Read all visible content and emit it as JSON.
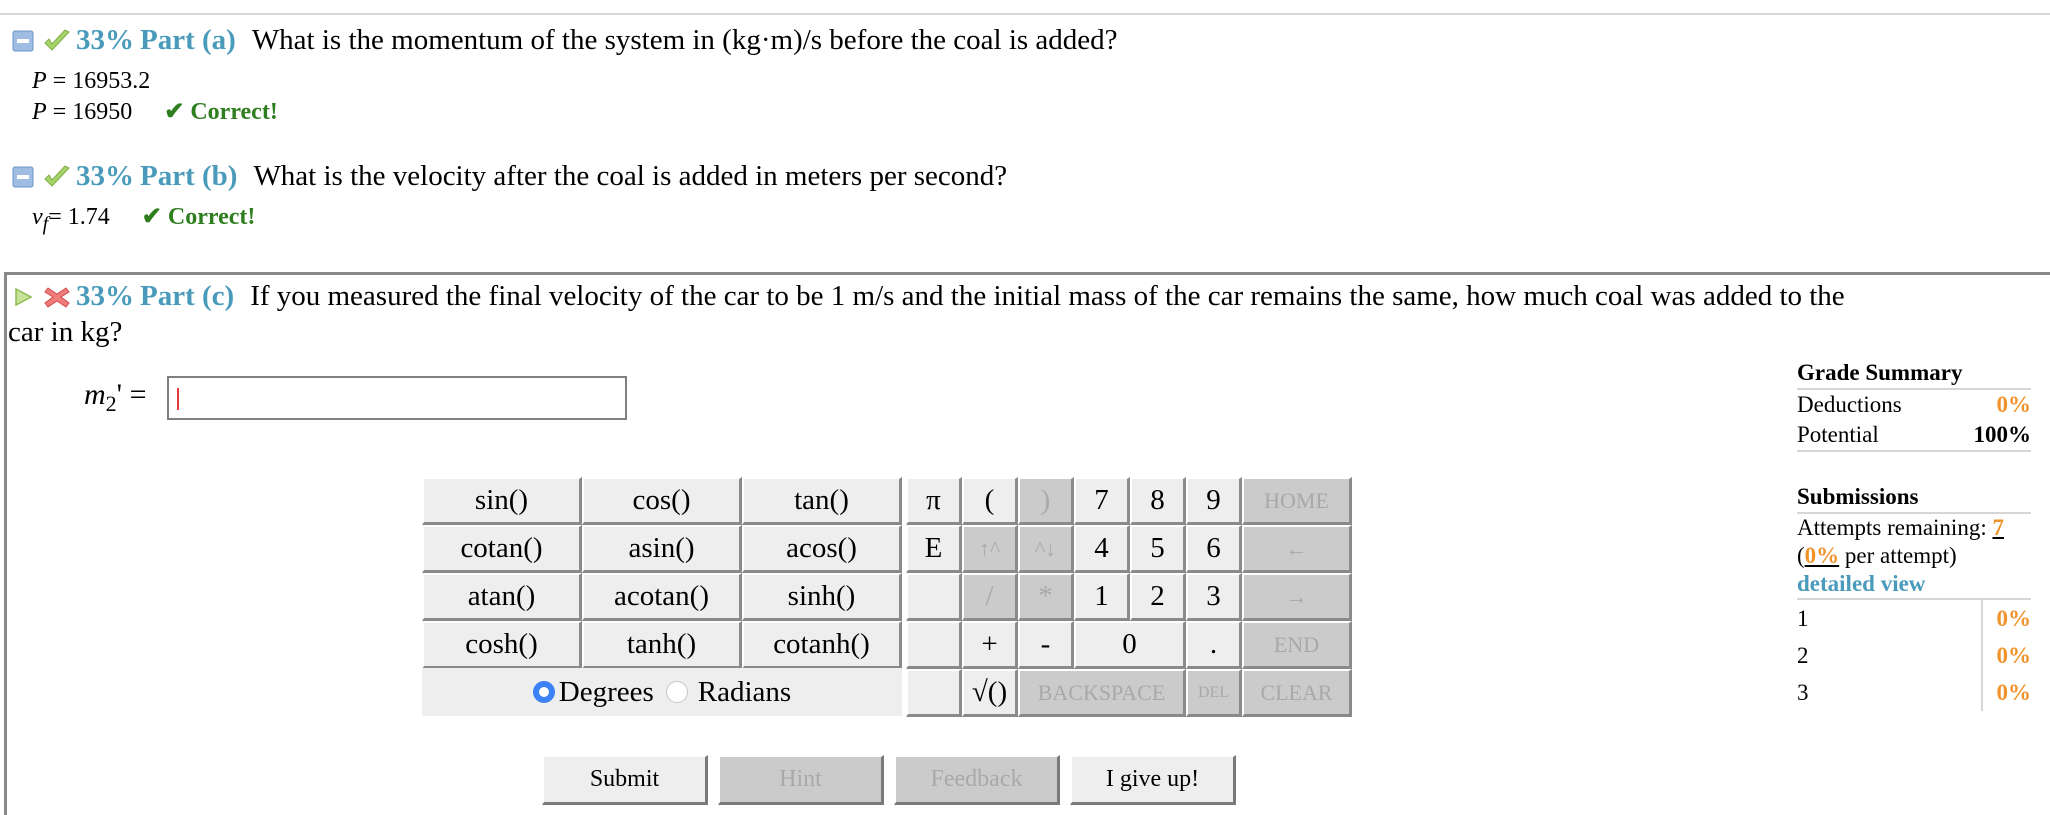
{
  "parts": [
    {
      "id": "a",
      "percent": "33%",
      "label": "Part (a)",
      "status": "correct",
      "question": "What is the momentum of the system in (kg·m)/s before the coal is added?",
      "answers": [
        {
          "var": "P",
          "text": " = 16953.2",
          "feedback": ""
        },
        {
          "var": "P",
          "text": " = 16950",
          "feedback": "✔ Correct!"
        }
      ]
    },
    {
      "id": "b",
      "percent": "33%",
      "label": "Part (b)",
      "status": "correct",
      "question": "What is the velocity after the coal is added in meters per second?",
      "answers": [
        {
          "var": "v",
          "sub": "f",
          "text": "= 1.74",
          "feedback": "✔ Correct!"
        }
      ]
    },
    {
      "id": "c",
      "percent": "33%",
      "label": "Part (c)",
      "status": "incorrect",
      "question_line1": "If you measured the final velocity of the car to be 1 m/s and the initial mass of the car remains the same, how much coal was added to the",
      "question_line2": "car in kg?",
      "input": {
        "var": "m",
        "sub": "2",
        "prime": "'",
        "eq": " =",
        "value": "",
        "placeholder": ""
      }
    }
  ],
  "icons": {
    "toggle_collapse": "collapse-icon",
    "toggle_expand": "expand-triangle-icon",
    "correct": "green-check-icon",
    "incorrect": "red-x-icon"
  },
  "keypad": {
    "functions": [
      [
        "sin()",
        "cos()",
        "tan()"
      ],
      [
        "cotan()",
        "asin()",
        "acos()"
      ],
      [
        "atan()",
        "acotan()",
        "sinh()"
      ],
      [
        "cosh()",
        "tanh()",
        "cotanh()"
      ]
    ],
    "angle_mode": {
      "options": [
        "Degrees",
        "Radians"
      ],
      "selected": "Degrees"
    },
    "keys": {
      "pi": "π",
      "e": "E",
      "lparen": "(",
      "rparen": ")",
      "up": "↑^",
      "down": "^↓",
      "divide": "/",
      "multiply": "*",
      "plus": "+",
      "minus": "-",
      "sqrt": "√()",
      "n7": "7",
      "n8": "8",
      "n9": "9",
      "n4": "4",
      "n5": "5",
      "n6": "6",
      "n1": "1",
      "n2": "2",
      "n3": "3",
      "n0": "0",
      "dot": ".",
      "home": "HOME",
      "left": "←",
      "right": "→",
      "end": "END",
      "backspace": "BACKSPACE",
      "del": "DEL",
      "clear": "CLEAR"
    }
  },
  "buttons": {
    "submit": "Submit",
    "hint": "Hint",
    "feedback": "Feedback",
    "give_up": "I give up!"
  },
  "grade_summary": {
    "title": "Grade Summary",
    "deductions_label": "Deductions",
    "deductions_value": "0%",
    "potential_label": "Potential",
    "potential_value": "100%"
  },
  "submissions": {
    "title": "Submissions",
    "attempts_label": "Attempts remaining: ",
    "attempts_value": "7",
    "per_attempt_open": "(",
    "per_attempt_value": "0%",
    "per_attempt_close": " per attempt)",
    "detailed_view": "detailed view",
    "rows": [
      {
        "n": "1",
        "value": "0%"
      },
      {
        "n": "2",
        "value": "0%"
      },
      {
        "n": "3",
        "value": "0%"
      }
    ]
  },
  "colors": {
    "part_label": "#4a9bbb",
    "correct": "#2e7d1f",
    "orange": "#f0932b"
  }
}
